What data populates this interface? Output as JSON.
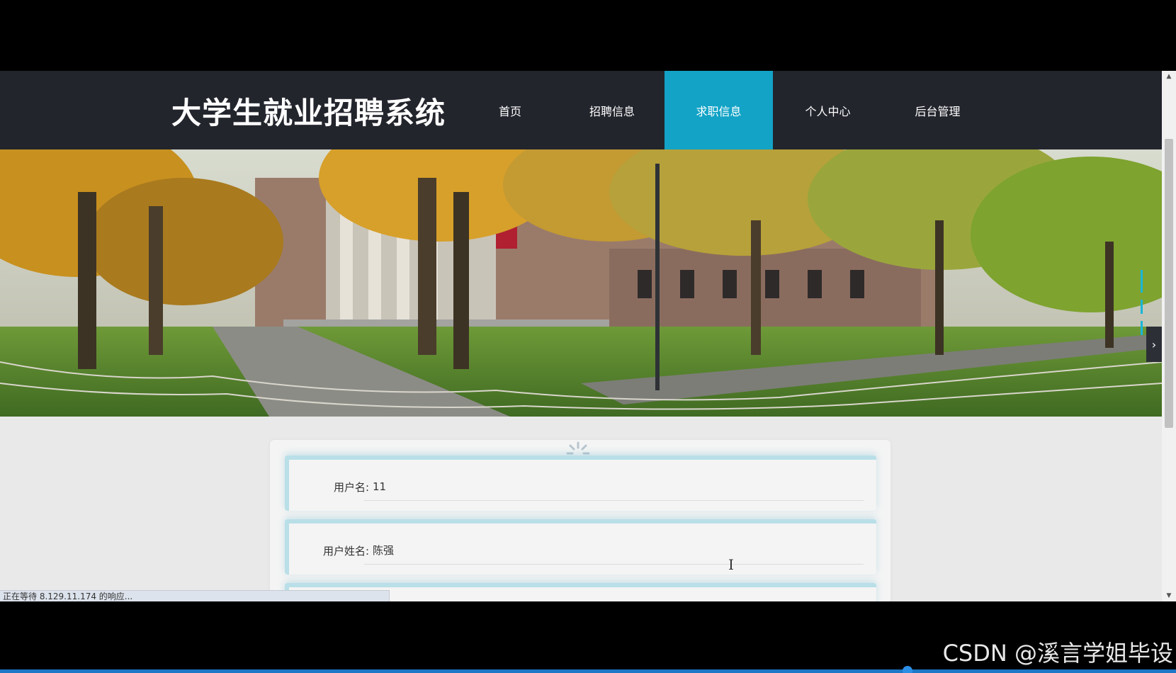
{
  "site": {
    "title": "大学生就业招聘系统"
  },
  "nav": {
    "items": [
      {
        "label": "首页"
      },
      {
        "label": "招聘信息"
      },
      {
        "label": "求职信息",
        "active": true
      },
      {
        "label": "个人中心"
      },
      {
        "label": "后台管理"
      }
    ]
  },
  "form": {
    "fields": [
      {
        "label": "用户名:",
        "value": "11"
      },
      {
        "label": "用户姓名:",
        "value": "陈强"
      }
    ]
  },
  "status": {
    "text": "正在等待 8.129.11.174 的响应..."
  },
  "watermark": {
    "text": "CSDN @溪言学姐毕设"
  },
  "colors": {
    "header_bg": "#23252d",
    "accent": "#12a3c6",
    "page_bg": "#e9e9e9"
  },
  "icons": {
    "loading": "spinner-icon",
    "slider_next": "chevron-right-icon",
    "scroll_up": "triangle-up-icon",
    "scroll_down": "triangle-down-icon"
  }
}
